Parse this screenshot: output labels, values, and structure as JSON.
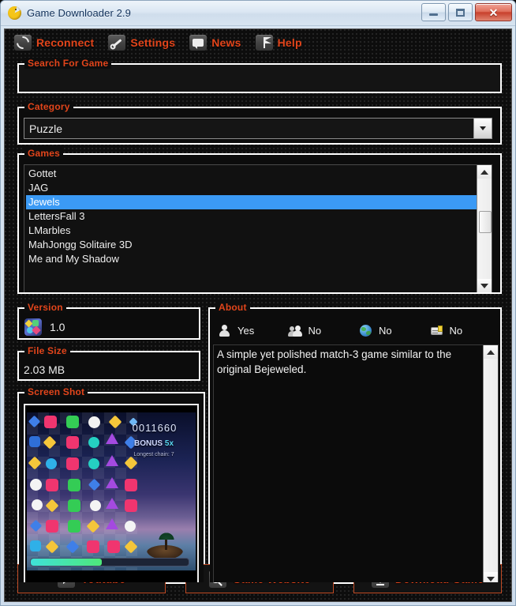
{
  "window": {
    "title": "Game Downloader 2.9",
    "app_icon": "pacman-icon",
    "minimize_label": "",
    "maximize_label": "",
    "close_label": "✕"
  },
  "toolbar": {
    "items": [
      {
        "label": "Reconnect",
        "icon": "refresh-icon"
      },
      {
        "label": "Settings",
        "icon": "wrench-icon"
      },
      {
        "label": "News",
        "icon": "chat-bubble-icon"
      },
      {
        "label": "Help",
        "icon": "flag-icon"
      }
    ]
  },
  "search": {
    "legend": "Search For Game",
    "value": "",
    "placeholder": ""
  },
  "category": {
    "legend": "Category",
    "selected": "Puzzle"
  },
  "games": {
    "legend": "Games",
    "items": [
      {
        "label": "Gottet",
        "selected": false
      },
      {
        "label": "JAG",
        "selected": false
      },
      {
        "label": "Jewels",
        "selected": true
      },
      {
        "label": "LettersFall 3",
        "selected": false
      },
      {
        "label": "LMarbles",
        "selected": false
      },
      {
        "label": "MahJongg Solitaire 3D",
        "selected": false
      },
      {
        "label": "Me and My Shadow",
        "selected": false
      }
    ],
    "selection_color": "#3b9af5"
  },
  "version": {
    "legend": "Version",
    "value": "1.0",
    "icon": "game-tile-icon"
  },
  "filesize": {
    "legend": "File Size",
    "value": "2.03 MB"
  },
  "screenshot": {
    "legend": "Screen Shot",
    "score": "0011660",
    "bonus_label": "BONUS",
    "bonus_value": "5x",
    "sub_label": "Longest chain: 7",
    "progress_percent": 45
  },
  "about": {
    "legend": "About",
    "attributes": [
      {
        "icon": "single-player-icon",
        "value": "Yes"
      },
      {
        "icon": "multiplayer-icon",
        "value": "No"
      },
      {
        "icon": "globe-icon",
        "value": "No"
      },
      {
        "icon": "card-icon",
        "value": "No"
      }
    ],
    "description": "A simple yet polished match-3 game similar to the original Bejeweled."
  },
  "footer": {
    "buttons": [
      {
        "label": "Youtube",
        "icon": "play-icon"
      },
      {
        "label": "Game Website",
        "icon": "search-icon"
      },
      {
        "label": "Download Game",
        "icon": "download-icon"
      }
    ]
  },
  "colors": {
    "accent": "#e2451b",
    "client_bg": "#0d0d0d",
    "selection": "#3b9af5",
    "group_border": "#ffffff"
  }
}
